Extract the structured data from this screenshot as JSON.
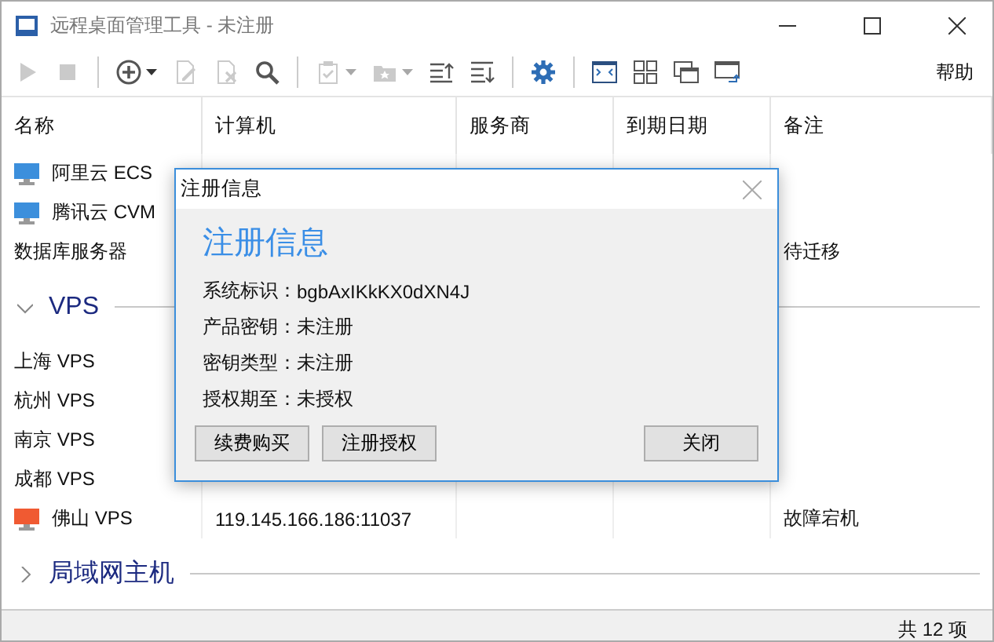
{
  "window": {
    "title": "远程桌面管理工具 - 未注册"
  },
  "toolbar": {
    "items": [
      {
        "kind": "play",
        "disabled": true,
        "menu": false
      },
      {
        "kind": "stop",
        "disabled": true,
        "menu": false
      },
      {
        "kind": "separator"
      },
      {
        "kind": "add",
        "disabled": false,
        "menu": true
      },
      {
        "kind": "edit",
        "disabled": true,
        "menu": false
      },
      {
        "kind": "delete",
        "disabled": true,
        "menu": false
      },
      {
        "kind": "search",
        "disabled": false,
        "menu": false
      },
      {
        "kind": "separator"
      },
      {
        "kind": "clipboard",
        "disabled": true,
        "menu": true
      },
      {
        "kind": "folder",
        "disabled": true,
        "menu": true
      },
      {
        "kind": "sort-up",
        "disabled": false,
        "menu": false
      },
      {
        "kind": "sort-down",
        "disabled": false,
        "menu": false
      },
      {
        "kind": "separator"
      },
      {
        "kind": "settings",
        "disabled": false,
        "menu": false
      },
      {
        "kind": "separator"
      },
      {
        "kind": "fullscreen",
        "disabled": false,
        "menu": false
      },
      {
        "kind": "grid",
        "disabled": false,
        "menu": false
      },
      {
        "kind": "windows",
        "disabled": false,
        "menu": false
      },
      {
        "kind": "switch",
        "disabled": false,
        "menu": false
      }
    ],
    "help": "帮助"
  },
  "table": {
    "columns": [
      "名称",
      "计算机",
      "服务商",
      "到期日期",
      "备注"
    ],
    "rows": [
      {
        "kind": "host",
        "name": "阿里云 ECS",
        "color": "#3c8fdc"
      },
      {
        "kind": "host",
        "name": "腾讯云 CVM",
        "color": "#3c8fdc"
      },
      {
        "kind": "host",
        "name": "数据库服务器",
        "note": "待迁移"
      },
      {
        "kind": "group",
        "label": "VPS",
        "expanded": true
      },
      {
        "kind": "host",
        "name": "上海 VPS"
      },
      {
        "kind": "host",
        "name": "杭州 VPS"
      },
      {
        "kind": "host",
        "name": "南京 VPS"
      },
      {
        "kind": "host",
        "name": "成都 VPS"
      },
      {
        "kind": "host",
        "name": "佛山 VPS",
        "color": "#f05a32",
        "computer": "119.145.166.186:11037",
        "note": "故障宕机"
      },
      {
        "kind": "group",
        "label": "局域网主机",
        "expanded": false
      }
    ]
  },
  "status_bar": "共 12 项",
  "dialog": {
    "title": "注册信息",
    "heading": "注册信息",
    "fields": [
      {
        "label": "系统标识：",
        "value": "bgbAxIKkKX0dXN4J"
      },
      {
        "label": "产品密钥：",
        "value": "未注册"
      },
      {
        "label": "密钥类型：",
        "value": "未注册"
      },
      {
        "label": "授权期至：",
        "value": "未授权"
      }
    ],
    "left_buttons": [
      "续费购买",
      "注册授权"
    ],
    "right_buttons": [
      "关闭"
    ]
  }
}
